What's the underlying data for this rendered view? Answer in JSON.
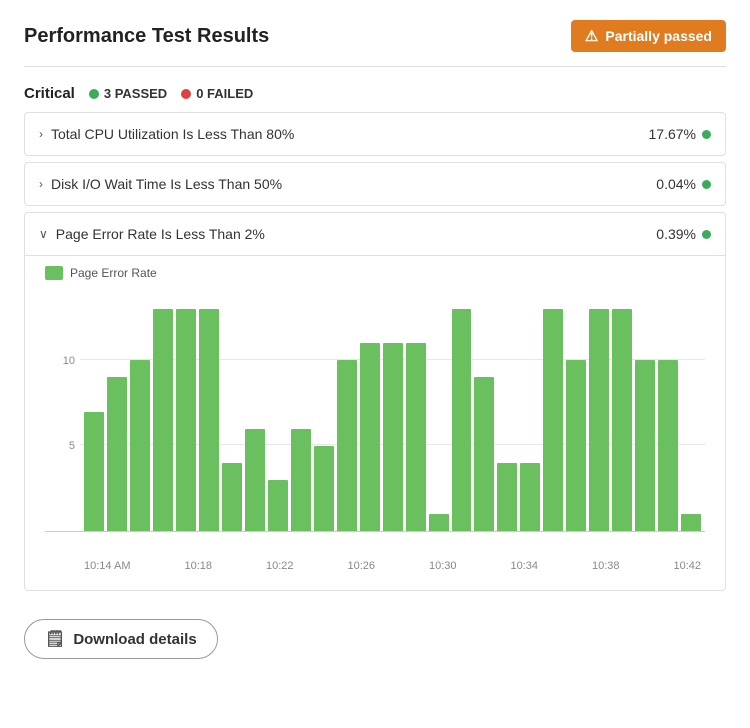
{
  "header": {
    "title": "Performance Test Results",
    "status_label": "Partially passed",
    "status_icon": "⚠"
  },
  "section": {
    "label": "Critical",
    "passed_count": "3 PASSED",
    "failed_count": "0 FAILED"
  },
  "rows": [
    {
      "id": "cpu",
      "label": "Total CPU Utilization Is Less Than 80%",
      "value": "17.67%",
      "expanded": false,
      "chevron": "›"
    },
    {
      "id": "disk",
      "label": "Disk I/O Wait Time Is Less Than 50%",
      "value": "0.04%",
      "expanded": false,
      "chevron": "›"
    },
    {
      "id": "error",
      "label": "Page Error Rate Is Less Than 2%",
      "value": "0.39%",
      "expanded": true,
      "chevron": "∨"
    }
  ],
  "chart": {
    "legend_label": "Page Error Rate",
    "y_labels": [
      "5",
      "10"
    ],
    "x_labels": [
      "10:14 AM",
      "10:18",
      "10:22",
      "10:26",
      "10:30",
      "10:34",
      "10:38",
      "10:42"
    ],
    "bars": [
      7,
      9,
      10,
      13,
      13,
      13,
      4,
      6,
      3,
      6,
      5,
      10,
      11,
      11,
      11,
      1,
      13,
      9,
      4,
      4,
      13,
      10,
      13,
      13,
      10,
      10,
      1
    ]
  },
  "download_button": {
    "label": "Download details"
  }
}
